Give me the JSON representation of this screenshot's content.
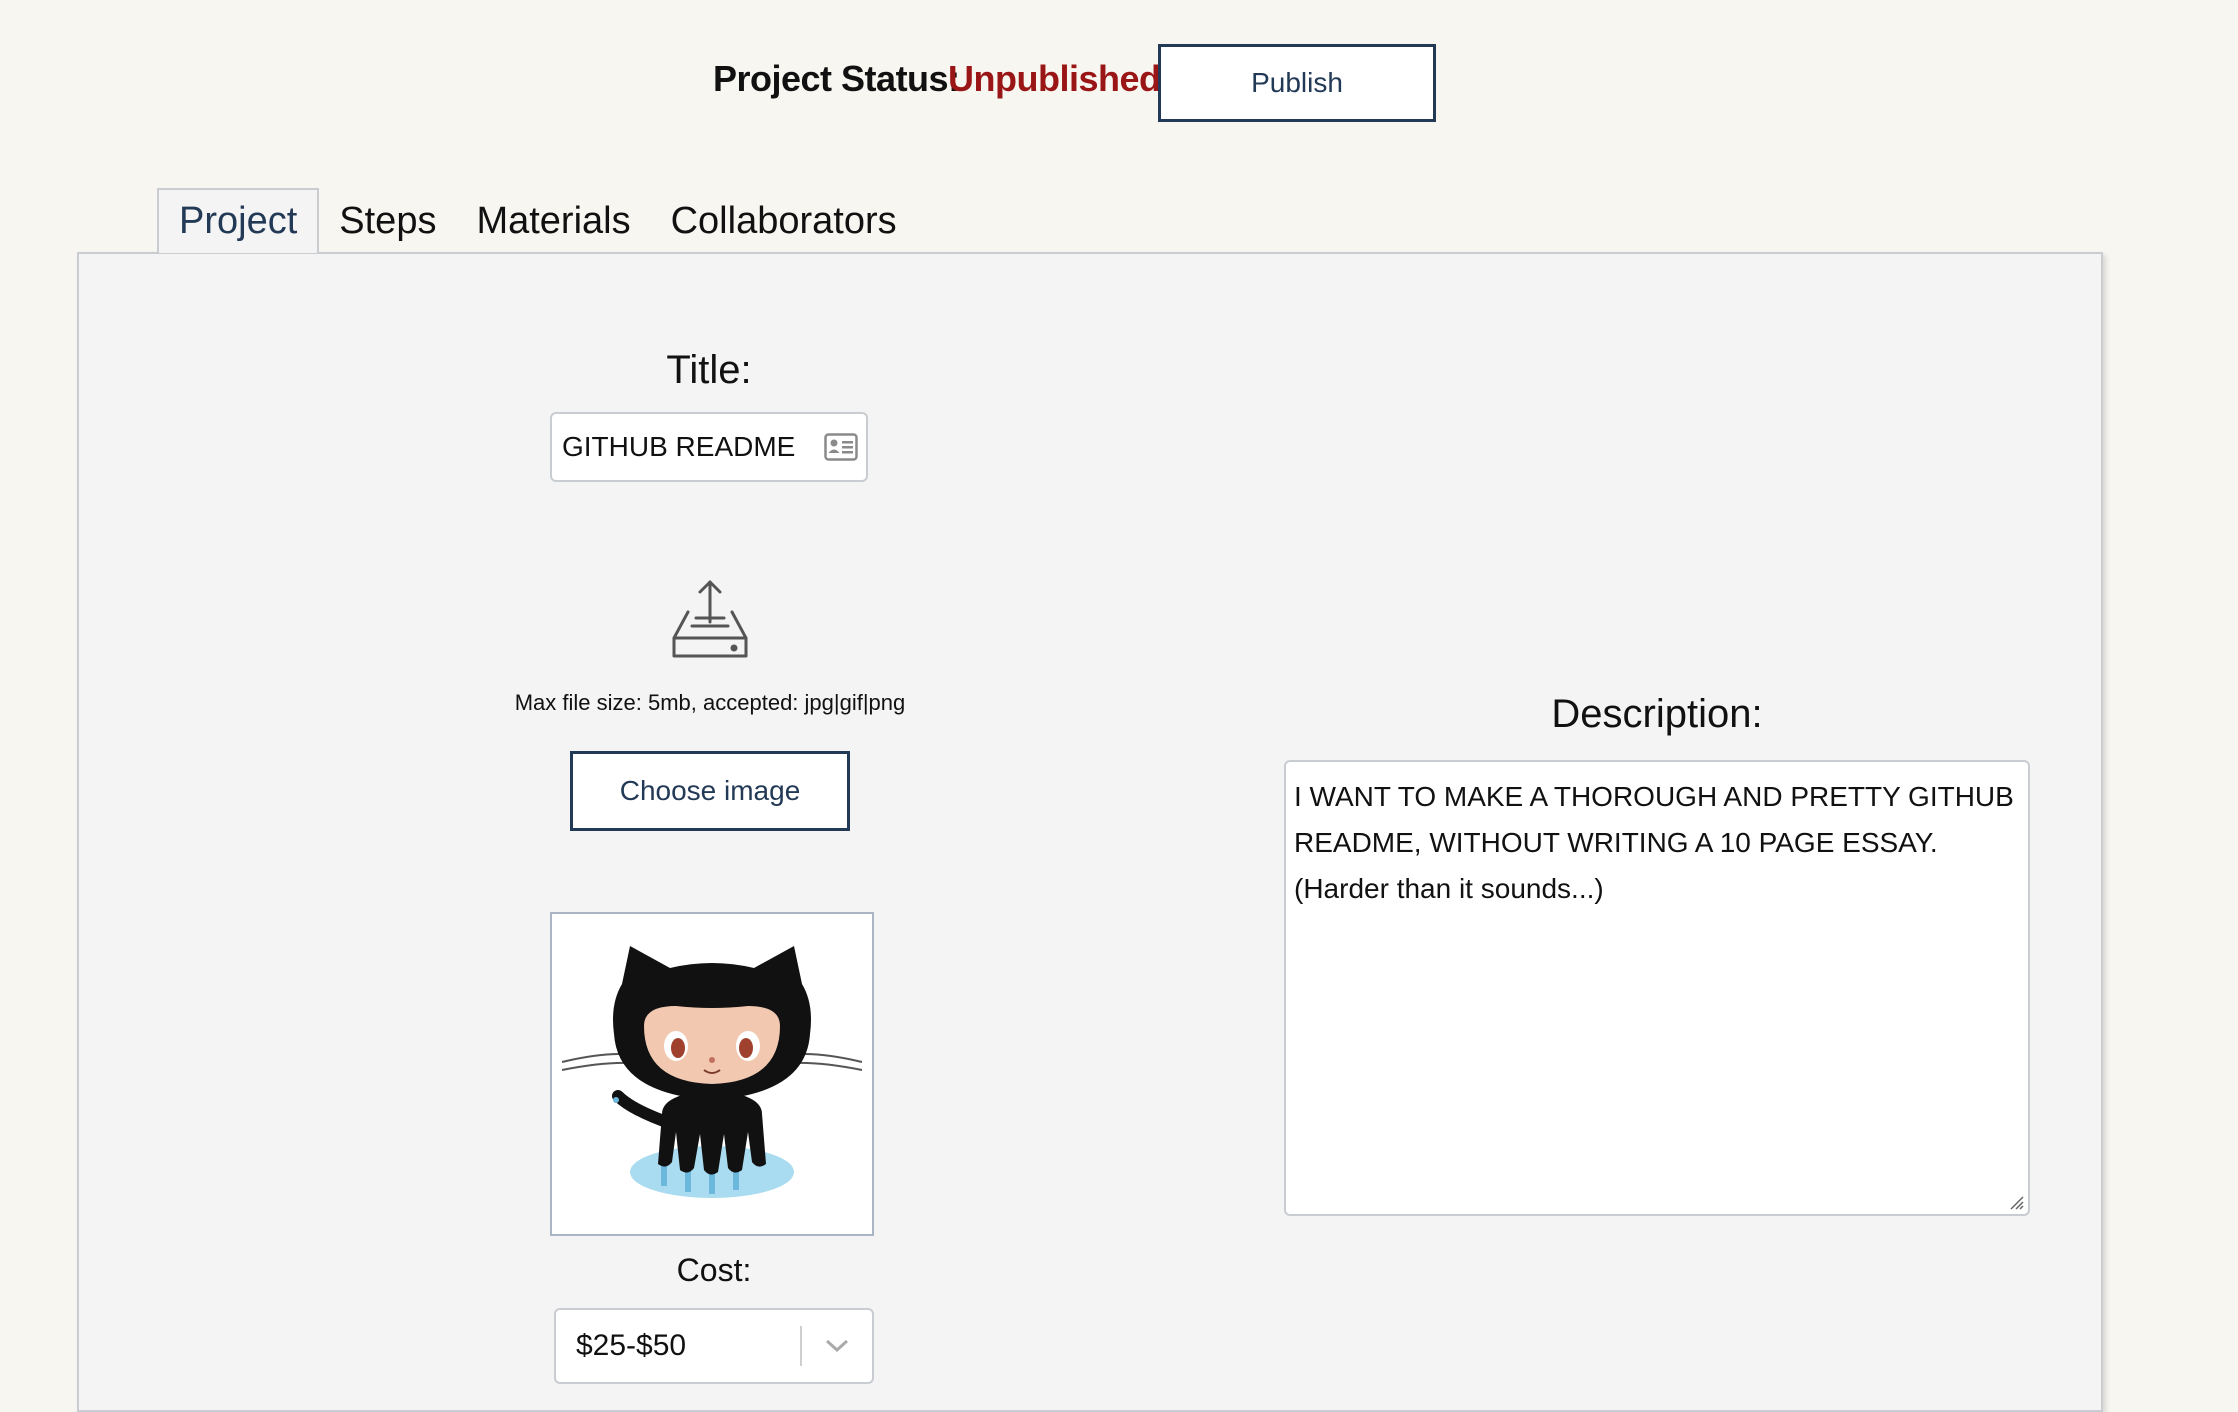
{
  "status": {
    "label": "Project Status:",
    "value": "Unpublished",
    "publish_label": "Publish"
  },
  "tabs": [
    {
      "label": "Project",
      "active": true
    },
    {
      "label": "Steps",
      "active": false
    },
    {
      "label": "Materials",
      "active": false
    },
    {
      "label": "Collaborators",
      "active": false
    }
  ],
  "project": {
    "title_label": "Title:",
    "title_value": "GITHUB README",
    "title_icon": "contact-card-icon",
    "upload_icon": "inbox-upload-icon",
    "file_hint": "Max file size: 5mb, accepted: jpg|gif|png",
    "choose_image_label": "Choose image",
    "image_alt": "octocat-image",
    "cost_label": "Cost:",
    "cost_value": "$25-$50",
    "description_label": "Description:",
    "description_lines": [
      "I WANT TO MAKE A THOROUGH AND PRETTY GITHUB",
      "README, WITHOUT WRITING A 10 PAGE ESSAY.",
      "(Harder than it sounds...)"
    ]
  },
  "colors": {
    "background": "#f7f6f0",
    "panel": "#f4f4f4",
    "accent": "#233a56",
    "status_unpublished": "#9a1616"
  }
}
